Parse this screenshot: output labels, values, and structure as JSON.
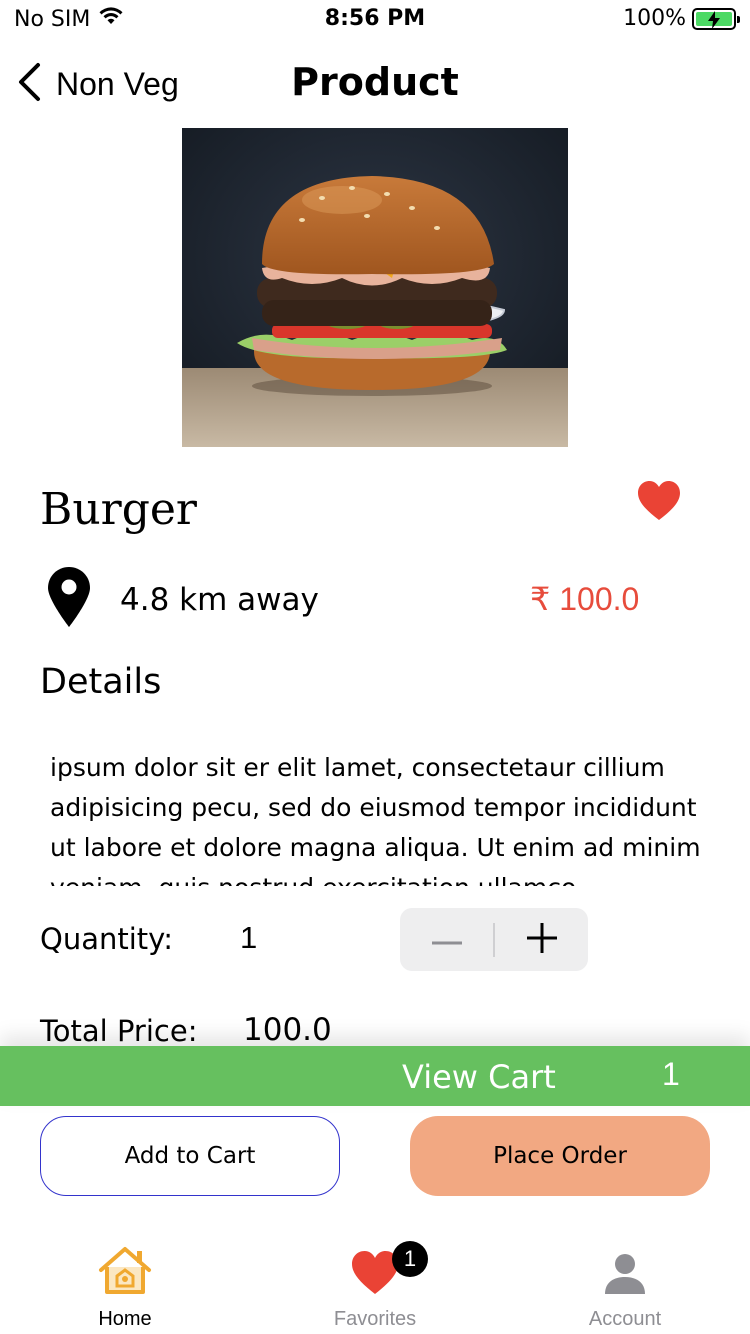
{
  "status_bar": {
    "carrier": "No SIM",
    "time": "8:56 PM",
    "battery": "100%"
  },
  "nav": {
    "back_label": "Non Veg",
    "title": "Product"
  },
  "product": {
    "name": "Burger",
    "distance": "4.8 km away",
    "price": "₹ 100.0",
    "details_heading": "Details",
    "details_text": "ipsum dolor sit er elit lamet, consectetaur cillium adipisicing pecu, sed do eiusmod tempor incididunt ut labore et dolore magna aliqua. Ut enim ad minim veniam, quis nostrud exercitation ullamco",
    "image_icon": "burger-photo"
  },
  "quantity": {
    "label": "Quantity:",
    "value": "1",
    "minus_icon": "minus-icon",
    "plus_icon": "plus-icon"
  },
  "total": {
    "label": "Total Price:",
    "value": "100.0"
  },
  "view_cart": {
    "label": "View Cart",
    "count": "1"
  },
  "buttons": {
    "add_to_cart": "Add to Cart",
    "place_order": "Place Order"
  },
  "tabs": [
    {
      "label": "Home",
      "icon": "home-icon"
    },
    {
      "label": "Favorites",
      "icon": "heart-icon",
      "badge": "1"
    },
    {
      "label": "Account",
      "icon": "person-icon"
    }
  ],
  "colors": {
    "price": "#e74c3c",
    "view_cart_bar": "#66c05f",
    "place_order": "#f2a882",
    "favorite_heart": "#ea4335",
    "home_tab_icon": "#f0a830"
  }
}
